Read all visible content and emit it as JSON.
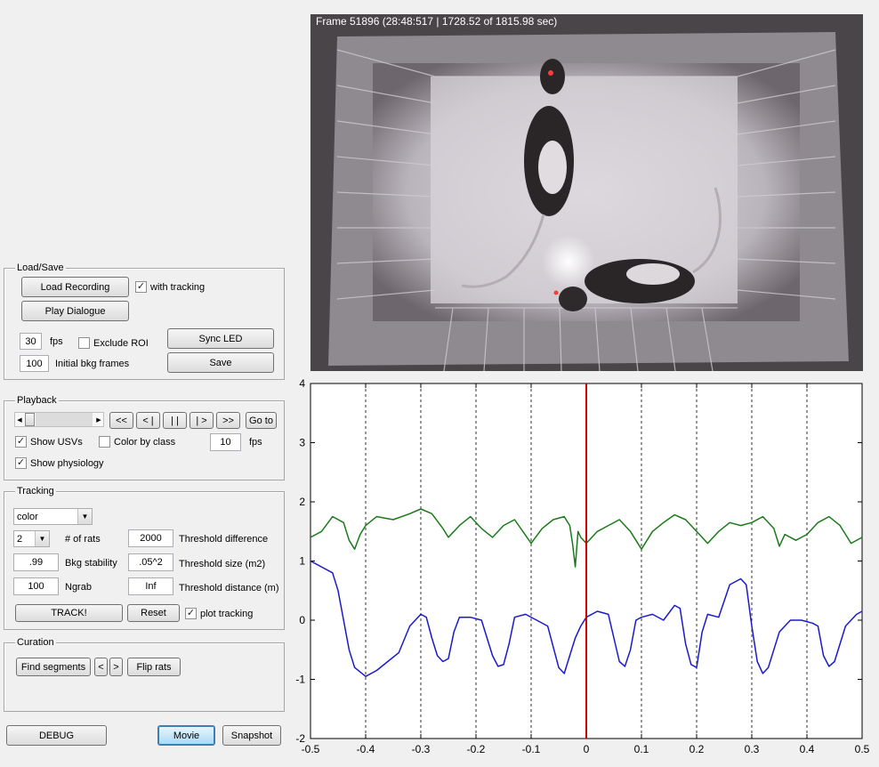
{
  "load_save": {
    "legend": "Load/Save",
    "load_recording": "Load Recording",
    "with_tracking": "with tracking",
    "with_tracking_checked": true,
    "play_dialogue": "Play Dialogue",
    "fps_value": "30",
    "fps_label": "fps",
    "exclude_roi": "Exclude ROI",
    "exclude_roi_checked": false,
    "sync_led": "Sync LED",
    "bkg_frames_value": "100",
    "bkg_frames_label": "Initial bkg frames",
    "save": "Save"
  },
  "playback": {
    "legend": "Playback",
    "slider_left_arrow": "◀",
    "slider_right_arrow": "▶",
    "rewind_fast": "<<",
    "step_back": "< |",
    "pause": "| |",
    "step_fwd": "| >",
    "forward_fast": ">>",
    "go_to": "Go to",
    "show_usvs": "Show USVs",
    "show_usvs_checked": true,
    "color_by_class": "Color by class",
    "color_by_class_checked": false,
    "fps_value": "10",
    "fps_label": "fps",
    "show_physiology": "Show physiology",
    "show_physiology_checked": true
  },
  "tracking": {
    "legend": "Tracking",
    "mode_value": "color",
    "num_rats_value": "2",
    "num_rats_label": "# of rats",
    "threshold_difference_value": "2000",
    "threshold_difference_label": "Threshold difference",
    "bkg_stability_value": ".99",
    "bkg_stability_label": "Bkg stability",
    "threshold_size_value": ".05^2",
    "threshold_size_label": "Threshold size (m2)",
    "ngrab_value": "100",
    "ngrab_label": "Ngrab",
    "threshold_distance_value": "Inf",
    "threshold_distance_label": "Threshold distance (m)",
    "track": "TRACK!",
    "reset": "Reset",
    "plot_tracking": "plot tracking",
    "plot_tracking_checked": true
  },
  "curation": {
    "legend": "Curation",
    "find_segments": "Find segments",
    "prev": "<",
    "next": ">",
    "flip_rats": "Flip rats"
  },
  "bottom": {
    "debug": "DEBUG",
    "movie": "Movie",
    "snapshot": "Snapshot"
  },
  "video": {
    "frame_info": "Frame 51896 (28:48:517 | 1728.52 of 1815.98 sec)"
  },
  "icons": {
    "dropdown": "chevron-down-icon",
    "checkbox_mark": "checkmark-icon"
  },
  "colors": {
    "green_trace": "#1a7a1a",
    "blue_trace": "#1a1acc",
    "cursor": "#d40000"
  },
  "chart_data": {
    "type": "line",
    "title": "",
    "xlabel": "",
    "ylabel": "",
    "xlim": [
      -0.5,
      0.5
    ],
    "ylim": [
      -2,
      4
    ],
    "xticks": [
      -0.5,
      -0.4,
      -0.3,
      -0.2,
      -0.1,
      0,
      0.1,
      0.2,
      0.3,
      0.4,
      0.5
    ],
    "xtick_labels": [
      "-0.5",
      "-0.4",
      "-0.3",
      "-0.2",
      "-0.1",
      "0",
      "0.1",
      "0.2",
      "0.3",
      "0.4",
      "0.5"
    ],
    "yticks": [
      -2,
      -1,
      0,
      1,
      2,
      3,
      4
    ],
    "ytick_labels": [
      "-2",
      "-1",
      "0",
      "1",
      "2",
      "3",
      "4"
    ],
    "grid": "vertical dashed at x ticks",
    "cursor_x": 0,
    "series": [
      {
        "color": "#1a7a1a",
        "x": [
          -0.5,
          -0.48,
          -0.46,
          -0.44,
          -0.43,
          -0.42,
          -0.41,
          -0.4,
          -0.38,
          -0.35,
          -0.32,
          -0.3,
          -0.28,
          -0.26,
          -0.25,
          -0.23,
          -0.21,
          -0.19,
          -0.17,
          -0.15,
          -0.13,
          -0.1,
          -0.08,
          -0.06,
          -0.04,
          -0.03,
          -0.025,
          -0.02,
          -0.015,
          -0.01,
          0.0,
          0.02,
          0.04,
          0.06,
          0.08,
          0.1,
          0.12,
          0.14,
          0.16,
          0.18,
          0.2,
          0.22,
          0.24,
          0.26,
          0.28,
          0.3,
          0.32,
          0.34,
          0.35,
          0.36,
          0.38,
          0.4,
          0.42,
          0.44,
          0.46,
          0.48,
          0.5
        ],
        "y": [
          1.4,
          1.5,
          1.75,
          1.65,
          1.35,
          1.2,
          1.45,
          1.6,
          1.75,
          1.7,
          1.8,
          1.88,
          1.8,
          1.55,
          1.4,
          1.6,
          1.75,
          1.55,
          1.4,
          1.6,
          1.7,
          1.3,
          1.55,
          1.7,
          1.75,
          1.6,
          1.3,
          0.9,
          1.5,
          1.4,
          1.3,
          1.5,
          1.6,
          1.7,
          1.5,
          1.2,
          1.5,
          1.65,
          1.78,
          1.7,
          1.5,
          1.3,
          1.5,
          1.65,
          1.6,
          1.65,
          1.75,
          1.55,
          1.25,
          1.45,
          1.35,
          1.45,
          1.65,
          1.75,
          1.6,
          1.3,
          1.4
        ]
      },
      {
        "color": "#1a1acc",
        "x": [
          -0.5,
          -0.48,
          -0.46,
          -0.45,
          -0.44,
          -0.43,
          -0.42,
          -0.4,
          -0.38,
          -0.36,
          -0.34,
          -0.32,
          -0.3,
          -0.29,
          -0.28,
          -0.27,
          -0.26,
          -0.25,
          -0.24,
          -0.23,
          -0.21,
          -0.19,
          -0.17,
          -0.16,
          -0.15,
          -0.14,
          -0.13,
          -0.11,
          -0.09,
          -0.07,
          -0.05,
          -0.04,
          -0.03,
          -0.02,
          -0.01,
          0.0,
          0.02,
          0.04,
          0.05,
          0.06,
          0.07,
          0.08,
          0.09,
          0.1,
          0.12,
          0.14,
          0.16,
          0.17,
          0.18,
          0.19,
          0.2,
          0.21,
          0.22,
          0.24,
          0.26,
          0.28,
          0.29,
          0.3,
          0.31,
          0.32,
          0.33,
          0.35,
          0.37,
          0.39,
          0.41,
          0.42,
          0.43,
          0.44,
          0.45,
          0.47,
          0.49,
          0.5
        ],
        "y": [
          1.0,
          0.9,
          0.8,
          0.5,
          0.0,
          -0.5,
          -0.8,
          -0.95,
          -0.85,
          -0.7,
          -0.55,
          -0.1,
          0.1,
          0.05,
          -0.3,
          -0.6,
          -0.7,
          -0.65,
          -0.2,
          0.05,
          0.05,
          0.0,
          -0.6,
          -0.78,
          -0.75,
          -0.4,
          0.05,
          0.1,
          0.0,
          -0.1,
          -0.8,
          -0.9,
          -0.6,
          -0.3,
          -0.1,
          0.05,
          0.15,
          0.1,
          -0.3,
          -0.7,
          -0.78,
          -0.5,
          0.0,
          0.05,
          0.1,
          0.0,
          0.25,
          0.2,
          -0.4,
          -0.75,
          -0.8,
          -0.2,
          0.1,
          0.05,
          0.6,
          0.7,
          0.6,
          -0.1,
          -0.7,
          -0.9,
          -0.8,
          -0.2,
          0.0,
          0.0,
          -0.05,
          -0.1,
          -0.6,
          -0.78,
          -0.7,
          -0.1,
          0.1,
          0.15
        ]
      }
    ]
  }
}
